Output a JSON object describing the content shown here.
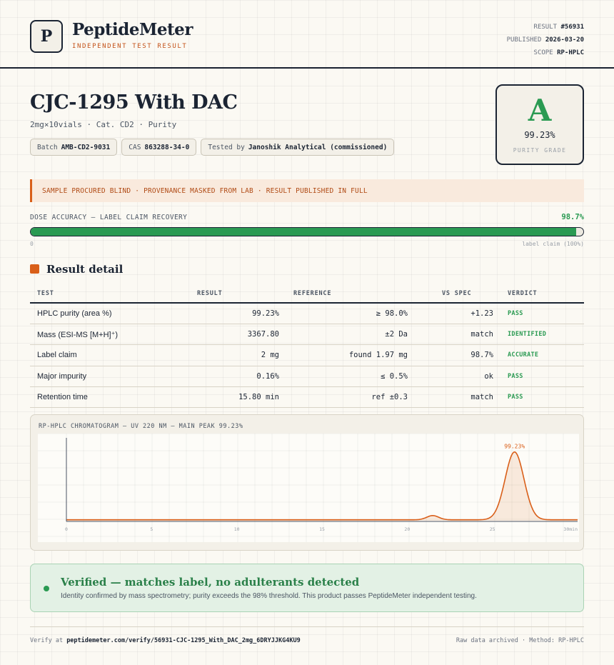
{
  "brand": {
    "logo_letter": "P",
    "name": "PeptideMeter",
    "tagline": "INDEPENDENT TEST RESULT"
  },
  "meta": {
    "result_label": "RESULT",
    "result_value": "#56931",
    "published_label": "PUBLISHED",
    "published_value": "2026-03-20",
    "scope_label": "SCOPE",
    "scope_value": "RP-HPLC"
  },
  "product": {
    "title": "CJC-1295 With DAC",
    "subtitle": "2mg×10vials · Cat. CD2 · Purity",
    "chips": [
      {
        "label": "Batch",
        "value": "AMB-CD2-9031"
      },
      {
        "label": "CAS",
        "value": "863288-34-0"
      },
      {
        "label": "Tested by",
        "value": "Janoshik Analytical (commissioned)"
      }
    ]
  },
  "grade": {
    "letter": "A",
    "value": "99.23%",
    "label": "PURITY GRADE"
  },
  "notice": "SAMPLE PROCURED BLIND · PROVENANCE MASKED FROM LAB · RESULT PUBLISHED IN FULL",
  "dose": {
    "label": "DOSE ACCURACY — LABEL CLAIM RECOVERY",
    "value_text": "98.7%",
    "fraction": 0.987,
    "min_label": "0",
    "max_label": "label claim (100%)"
  },
  "section_title": "Result detail",
  "table": {
    "headers": [
      "TEST",
      "RESULT",
      "REFERENCE",
      "VS SPEC",
      "VERDICT"
    ],
    "rows": [
      {
        "test": "HPLC purity (area %)",
        "result": "99.23%",
        "reference": "≥ 98.0%",
        "vs": "+1.23",
        "verdict": "PASS"
      },
      {
        "test": "Mass (ESI-MS [M+H]⁺)",
        "result": "3367.80",
        "reference": "±2 Da",
        "vs": "match",
        "verdict": "IDENTIFIED"
      },
      {
        "test": "Label claim",
        "result": "2 mg",
        "reference": "found 1.97 mg",
        "vs": "98.7%",
        "verdict": "ACCURATE"
      },
      {
        "test": "Major impurity",
        "result": "0.16%",
        "reference": "≤ 0.5%",
        "vs": "ok",
        "verdict": "PASS"
      },
      {
        "test": "Retention time",
        "result": "15.80 min",
        "reference": "ref ±0.3",
        "vs": "match",
        "verdict": "PASS"
      }
    ]
  },
  "chromatogram": {
    "title": "RP-HPLC CHROMATOGRAM — UV 220 NM — MAIN PEAK 99.23%",
    "peak_label": "99.23%",
    "line_color": "#d95f19",
    "chart_data": {
      "type": "line",
      "x_ticks": [
        "0",
        "5",
        "10",
        "15",
        "20",
        "25",
        "30min"
      ],
      "xlim": [
        0,
        30
      ],
      "peaks": [
        {
          "x": 21.5,
          "height": 0.055,
          "width": 0.35
        },
        {
          "x": 26.3,
          "height": 0.88,
          "width": 0.55
        }
      ],
      "baseline": 0.012
    }
  },
  "verified": {
    "title": "Verified — matches label, no adulterants detected",
    "description": "Identity confirmed by mass spectrometry; purity exceeds the 98% threshold. This product passes PeptideMeter independent testing."
  },
  "footer": {
    "verify_prefix": "Verify at",
    "verify_url": "peptidemeter.com/verify/56931-CJC-1295_With_DAC_2mg_6DRYJJKG4KU9",
    "right": "Raw data archived · Method: RP-HPLC"
  },
  "colors": {
    "accent": "#d95f19",
    "pass": "#2a9a52",
    "ink": "#1b2433"
  }
}
